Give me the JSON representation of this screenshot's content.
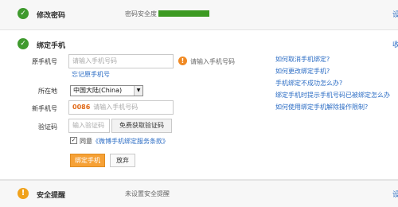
{
  "change_password_row": {
    "title": "修改密码",
    "strength_label": "密码安全度",
    "edge_link": "设"
  },
  "bind_phone": {
    "title": "绑定手机",
    "collapse_link": "收",
    "phone_label": "原手机号",
    "phone_placeholder": "请输入手机号码",
    "phone_hint": "请输入手机号码",
    "forgot_link": "忘记原手机号",
    "region_label": "所在地",
    "region_value": "中国大陆(China)",
    "new_phone_label": "新手机号",
    "new_phone_prefix": "0086",
    "new_phone_placeholder": "请输入手机号码",
    "code_label": "验证码",
    "code_placeholder": "输入验证码",
    "get_code_button": "免费获取验证码",
    "agree_text": "同意",
    "agree_link": "《微博手机绑定服务条款》",
    "bind_button": "绑定手机",
    "cancel_button": "放弃"
  },
  "help_links": [
    "如何取消手机绑定?",
    "如何更改绑定手机?",
    "手机绑定不成功怎么办?",
    "绑定手机时提示手机号码已被绑定怎么办",
    "如何使用绑定手机解除操作限制?"
  ],
  "security_alert_row": {
    "title": "安全提醒",
    "status": "未设置安全提醒",
    "edge_link": "设"
  },
  "colors": {
    "accent_orange": "#f6a136",
    "link_blue": "#2b6cc4",
    "success_green": "#3f9a2e",
    "warning_orange": "#f08a24"
  },
  "password_strength": 1.0
}
